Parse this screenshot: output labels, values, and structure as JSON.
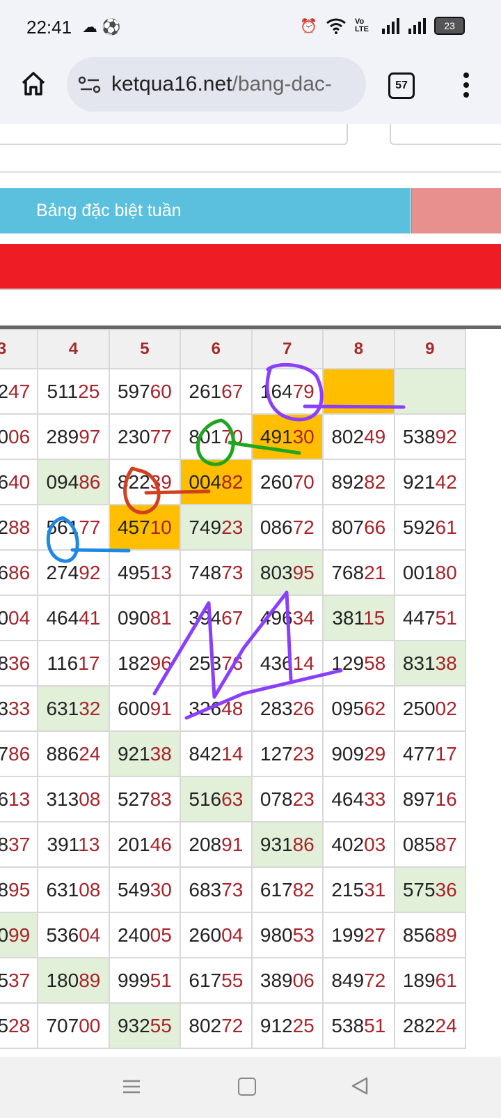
{
  "status_bar": {
    "time": "22:41",
    "left_icons": [
      "cloud-icon",
      "soccer-ball-icon"
    ],
    "right_icons": [
      "alarm-icon",
      "wifi-icon",
      "volte-icon",
      "signal-icon",
      "signal-icon"
    ],
    "volte_label": "Vo LTE",
    "battery_level": "23"
  },
  "browser": {
    "url_host": "ketqua16.net",
    "url_path": "/bang-dac-",
    "tab_count": "57"
  },
  "page": {
    "tab_active_label": "Bảng đặc biệt tuần"
  },
  "table": {
    "headers": [
      "3",
      "4",
      "5",
      "6",
      "7",
      "8",
      "9"
    ],
    "rows": [
      [
        {
          "a": "2",
          "b": "47"
        },
        {
          "a": "511",
          "b": "25"
        },
        {
          "a": "597",
          "b": "60"
        },
        {
          "a": "261",
          "b": "67"
        },
        {
          "a": "164",
          "b": "79"
        },
        {
          "a": "",
          "b": "",
          "hl": "gold"
        },
        {
          "a": "",
          "b": "",
          "hl": "green"
        }
      ],
      [
        {
          "a": "0",
          "b": "06"
        },
        {
          "a": "289",
          "b": "97"
        },
        {
          "a": "230",
          "b": "77"
        },
        {
          "a": "801",
          "b": "70"
        },
        {
          "a": "491",
          "b": "30",
          "hl": "gold"
        },
        {
          "a": "802",
          "b": "49"
        },
        {
          "a": "538",
          "b": "92"
        }
      ],
      [
        {
          "a": "6",
          "b": "40"
        },
        {
          "a": "094",
          "b": "86",
          "hl": "green"
        },
        {
          "a": "822",
          "b": "39"
        },
        {
          "a": "004",
          "b": "82",
          "hl": "gold"
        },
        {
          "a": "260",
          "b": "70"
        },
        {
          "a": "892",
          "b": "82"
        },
        {
          "a": "921",
          "b": "42"
        }
      ],
      [
        {
          "a": "2",
          "b": "88"
        },
        {
          "a": "561",
          "b": "77"
        },
        {
          "a": "457",
          "b": "10",
          "hl": "gold"
        },
        {
          "a": "749",
          "b": "23",
          "hl": "green"
        },
        {
          "a": "086",
          "b": "72"
        },
        {
          "a": "807",
          "b": "66"
        },
        {
          "a": "592",
          "b": "61"
        }
      ],
      [
        {
          "a": "6",
          "b": "86"
        },
        {
          "a": "274",
          "b": "92"
        },
        {
          "a": "495",
          "b": "13"
        },
        {
          "a": "748",
          "b": "73"
        },
        {
          "a": "803",
          "b": "95",
          "hl": "green"
        },
        {
          "a": "768",
          "b": "21"
        },
        {
          "a": "001",
          "b": "80"
        }
      ],
      [
        {
          "a": "0",
          "b": "04"
        },
        {
          "a": "464",
          "b": "41"
        },
        {
          "a": "090",
          "b": "81"
        },
        {
          "a": "394",
          "b": "67"
        },
        {
          "a": "496",
          "b": "34"
        },
        {
          "a": "381",
          "b": "15",
          "hl": "green"
        },
        {
          "a": "447",
          "b": "51"
        }
      ],
      [
        {
          "a": "8",
          "b": "36"
        },
        {
          "a": "116",
          "b": "17"
        },
        {
          "a": "182",
          "b": "96"
        },
        {
          "a": "253",
          "b": "76"
        },
        {
          "a": "436",
          "b": "14"
        },
        {
          "a": "129",
          "b": "58"
        },
        {
          "a": "831",
          "b": "38",
          "hl": "green"
        }
      ],
      [
        {
          "a": "3",
          "b": "33"
        },
        {
          "a": "631",
          "b": "32",
          "hl": "green"
        },
        {
          "a": "600",
          "b": "91"
        },
        {
          "a": "326",
          "b": "48"
        },
        {
          "a": "283",
          "b": "26"
        },
        {
          "a": "095",
          "b": "62"
        },
        {
          "a": "250",
          "b": "02"
        }
      ],
      [
        {
          "a": "7",
          "b": "86"
        },
        {
          "a": "886",
          "b": "24"
        },
        {
          "a": "921",
          "b": "38",
          "hl": "green"
        },
        {
          "a": "842",
          "b": "14"
        },
        {
          "a": "127",
          "b": "23"
        },
        {
          "a": "909",
          "b": "29"
        },
        {
          "a": "477",
          "b": "17"
        }
      ],
      [
        {
          "a": "6",
          "b": "13"
        },
        {
          "a": "313",
          "b": "08"
        },
        {
          "a": "527",
          "b": "83"
        },
        {
          "a": "516",
          "b": "63",
          "hl": "green"
        },
        {
          "a": "078",
          "b": "23"
        },
        {
          "a": "464",
          "b": "33"
        },
        {
          "a": "897",
          "b": "16"
        }
      ],
      [
        {
          "a": "8",
          "b": "37"
        },
        {
          "a": "391",
          "b": "13"
        },
        {
          "a": "201",
          "b": "46"
        },
        {
          "a": "208",
          "b": "91"
        },
        {
          "a": "931",
          "b": "86",
          "hl": "green"
        },
        {
          "a": "402",
          "b": "03"
        },
        {
          "a": "085",
          "b": "87"
        }
      ],
      [
        {
          "a": "8",
          "b": "95"
        },
        {
          "a": "631",
          "b": "08"
        },
        {
          "a": "549",
          "b": "30"
        },
        {
          "a": "683",
          "b": "73"
        },
        {
          "a": "617",
          "b": "82"
        },
        {
          "a": "215",
          "b": "31"
        },
        {
          "a": "575",
          "b": "36",
          "hl": "green"
        }
      ],
      [
        {
          "a": "0",
          "b": "99",
          "hl": "green"
        },
        {
          "a": "536",
          "b": "04"
        },
        {
          "a": "240",
          "b": "05"
        },
        {
          "a": "260",
          "b": "04"
        },
        {
          "a": "980",
          "b": "53"
        },
        {
          "a": "199",
          "b": "27"
        },
        {
          "a": "856",
          "b": "89"
        }
      ],
      [
        {
          "a": "5",
          "b": "37"
        },
        {
          "a": "180",
          "b": "89",
          "hl": "green"
        },
        {
          "a": "999",
          "b": "51"
        },
        {
          "a": "617",
          "b": "55"
        },
        {
          "a": "389",
          "b": "06"
        },
        {
          "a": "849",
          "b": "72"
        },
        {
          "a": "189",
          "b": "61"
        }
      ],
      [
        {
          "a": "5",
          "b": "28"
        },
        {
          "a": "707",
          "b": "00"
        },
        {
          "a": "932",
          "b": "55",
          "hl": "green"
        },
        {
          "a": "802",
          "b": "72"
        },
        {
          "a": "912",
          "b": "25"
        },
        {
          "a": "538",
          "b": "51"
        },
        {
          "a": "282",
          "b": "24"
        }
      ]
    ]
  },
  "colors": {
    "tab_active": "#5bc0de",
    "tab_inactive": "#e7908e",
    "banner": "#ee1c25",
    "highlight_gold": "#ffbe00",
    "highlight_green": "#e2f0d9",
    "number_tail": "#a8232a",
    "annotation_purple": "#8a3ffc",
    "annotation_green": "#1fa51f",
    "annotation_red": "#d1401f",
    "annotation_blue": "#1e88e5"
  },
  "nav": {
    "icons": [
      "menu-icon",
      "home-square-icon",
      "back-triangle-icon"
    ]
  }
}
